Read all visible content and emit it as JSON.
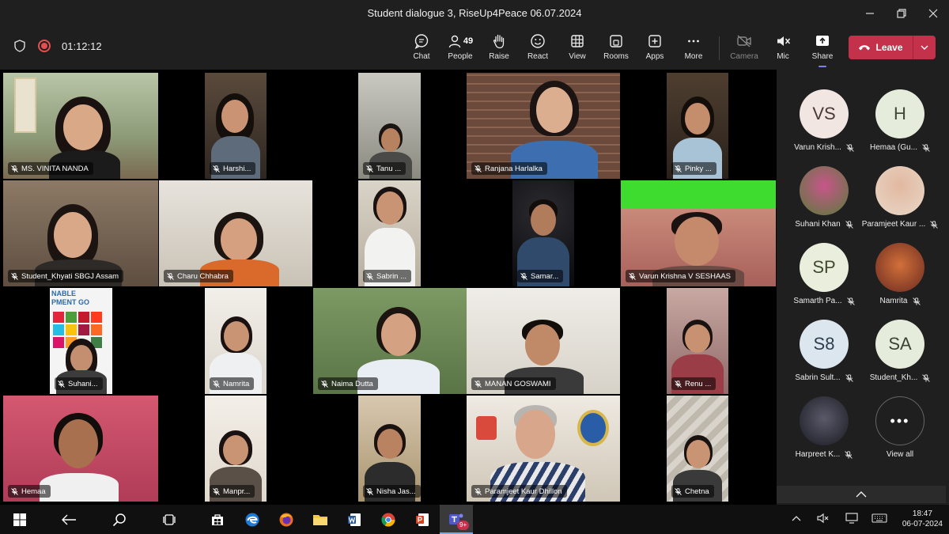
{
  "window": {
    "title": "Student dialogue 3, RiseUp4Peace 06.07.2024",
    "minimize_icon": "minimize-icon",
    "maximize_icon": "maximize-icon",
    "close_icon": "close-icon"
  },
  "meeting": {
    "timer": "01:12:12",
    "people_count": "49"
  },
  "toolbar": {
    "chat": "Chat",
    "people": "People",
    "raise": "Raise",
    "react": "React",
    "view": "View",
    "rooms": "Rooms",
    "apps": "Apps",
    "more": "More",
    "camera": "Camera",
    "mic": "Mic",
    "share": "Share",
    "leave": "Leave"
  },
  "tiles": [
    {
      "name": "MS. VINITA NANDA"
    },
    {
      "name": "Harshi..."
    },
    {
      "name": "Tanu ..."
    },
    {
      "name": "Ranjana Harlalka"
    },
    {
      "name": "Pinky ..."
    },
    {
      "name": "Student_Khyati SBGJ Assam"
    },
    {
      "name": "Charu Chhabra"
    },
    {
      "name": "Sabrin ..."
    },
    {
      "name": "Samar..."
    },
    {
      "name": "Varun Krishna V SESHAAS"
    },
    {
      "name": "Suhani..."
    },
    {
      "name": "Namrita"
    },
    {
      "name": "Naima Dutta"
    },
    {
      "name": "MANAN GOSWAMI"
    },
    {
      "name": "Renu ..."
    },
    {
      "name": "Hemaa"
    },
    {
      "name": "Manpr..."
    },
    {
      "name": "Nisha Jas..."
    },
    {
      "name": "Paramjeet Kaur Dhillon"
    },
    {
      "name": "Chetna"
    }
  ],
  "sdg_poster": {
    "line1": "NABLE",
    "line2": "PMENT GO"
  },
  "roster": [
    {
      "initials": "VS",
      "name": "Varun Krish..."
    },
    {
      "initials": "H",
      "name": "Hemaa (Gu..."
    },
    {
      "initials": "",
      "name": "Suhani Khan"
    },
    {
      "initials": "",
      "name": "Paramjeet Kaur ..."
    },
    {
      "initials": "SP",
      "name": "Samarth Pa..."
    },
    {
      "initials": "",
      "name": "Namrita"
    },
    {
      "initials": "S8",
      "name": "Sabrin Sult..."
    },
    {
      "initials": "SA",
      "name": "Student_Kh..."
    },
    {
      "initials": "",
      "name": "Harpreet K..."
    }
  ],
  "view_all": {
    "dots": "•••",
    "label": "View all"
  },
  "taskbar": {
    "teams_badge": "9+",
    "time": "18:47",
    "date": "06-07-2024"
  }
}
